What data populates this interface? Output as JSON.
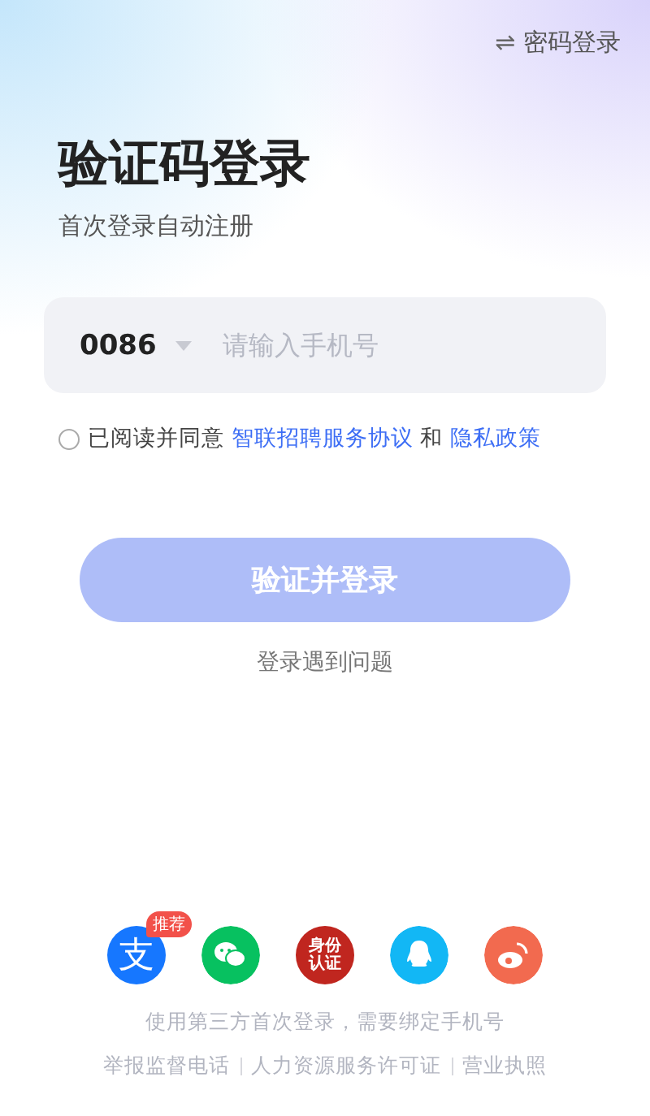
{
  "switch_link": {
    "icon": "⇌",
    "label": "密码登录"
  },
  "title": "验证码登录",
  "subtitle": "首次登录自动注册",
  "phone": {
    "country_code": "0086",
    "placeholder": "请输入手机号"
  },
  "agreement": {
    "checked": false,
    "text": "已阅读并同意",
    "link1": "智联招聘服务协议",
    "and": "和",
    "link2": "隐私政策"
  },
  "submit": {
    "label": "验证并登录",
    "disabled": true
  },
  "help_link": "登录遇到问题",
  "third_party": [
    {
      "kind": "alipay",
      "glyph": "支",
      "badge": "推荐",
      "color": "#1677ff"
    },
    {
      "kind": "wechat",
      "color": "#07c160"
    },
    {
      "kind": "id",
      "glyph": "身份认证",
      "color": "#c0261f"
    },
    {
      "kind": "qq",
      "color": "#12b7f5"
    },
    {
      "kind": "weibo",
      "color": "#f26a4f"
    }
  ],
  "third_party_note": "使用第三方首次登录，需要绑定手机号",
  "footer_links": [
    "举报监督电话",
    "人力资源服务许可证",
    "营业执照"
  ]
}
